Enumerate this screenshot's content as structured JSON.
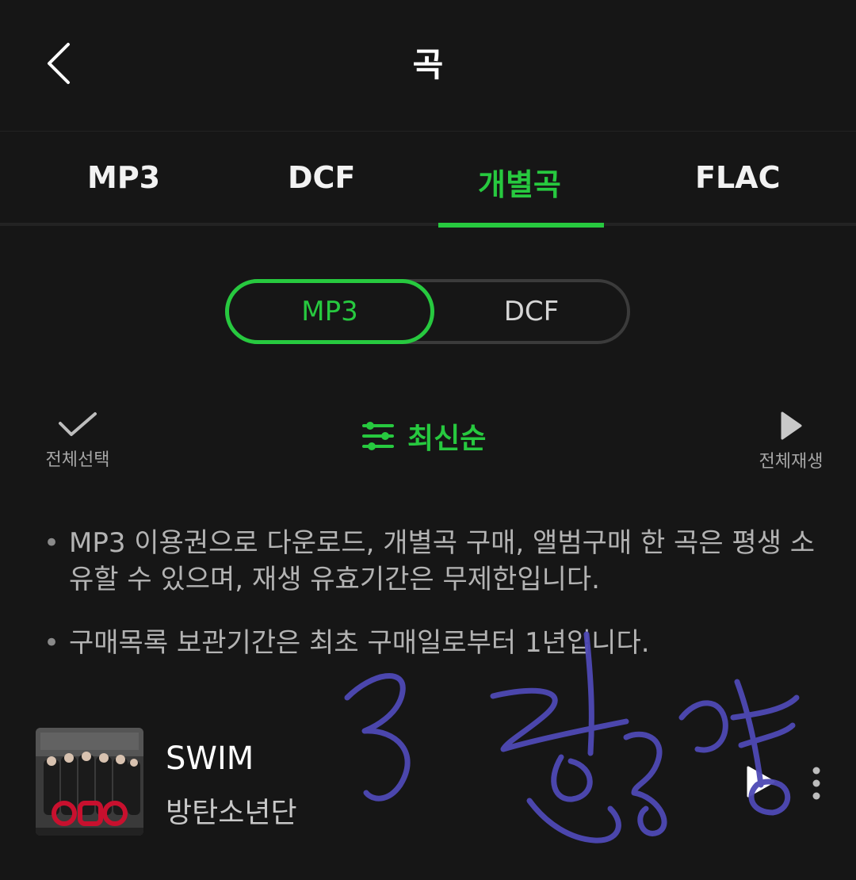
{
  "header": {
    "title": "곡"
  },
  "tabs": [
    {
      "label": "MP3",
      "active": false
    },
    {
      "label": "DCF",
      "active": false
    },
    {
      "label": "개별곡",
      "active": true
    },
    {
      "label": "FLAC",
      "active": false
    }
  ],
  "segment": {
    "options": [
      "MP3",
      "DCF"
    ],
    "selected": "MP3"
  },
  "toolbar": {
    "select_all": "전체선택",
    "sort": "최신순",
    "play_all": "전체재생"
  },
  "notices": [
    "MP3 이용권으로 다운로드, 개별곡 구매, 앨범구매 한 곡은 평생 소유할 수 있으며, 재생 유효기간은 무제한입니다.",
    "구매목록 보관기간은 최초 구매일로부터 1년입니다."
  ],
  "tracks": [
    {
      "title": "SWIM",
      "artist": "방탄소년단"
    }
  ],
  "colors": {
    "accent": "#27c93f",
    "background": "#161616",
    "scribble": "#4e49b5"
  },
  "icons": [
    "back-chevron-icon",
    "checkmark-icon",
    "sort-sliders-icon",
    "play-icon",
    "more-vertical-icon"
  ]
}
